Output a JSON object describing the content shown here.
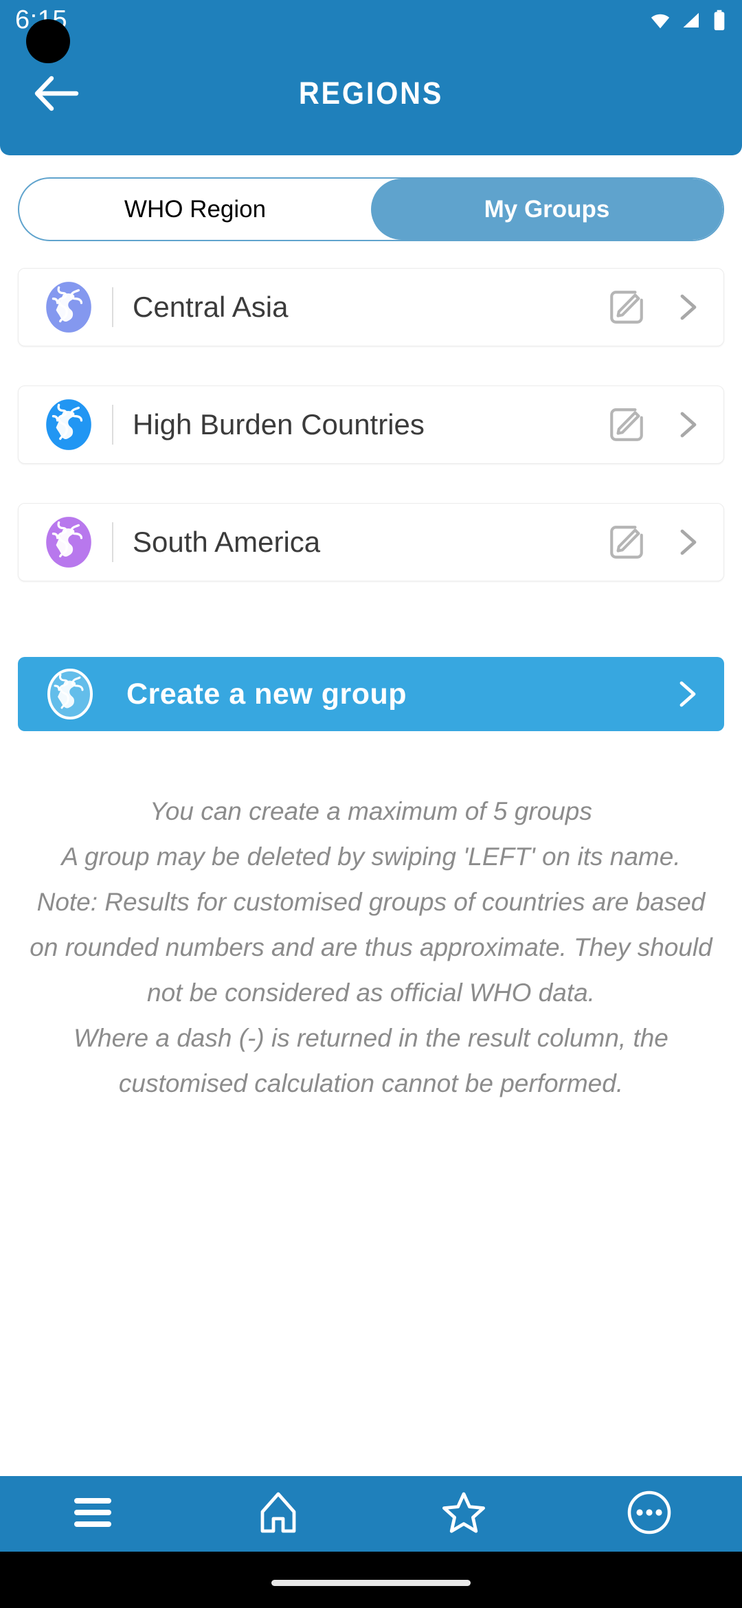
{
  "status_bar": {
    "time": "6:15",
    "icons": [
      "wifi-icon",
      "cellular-signal-icon",
      "battery-icon"
    ]
  },
  "header": {
    "title": "REGIONS",
    "back_icon": "back-arrow-icon",
    "background_color": "#1f80bb"
  },
  "tabs": {
    "items": [
      {
        "label": "WHO Region",
        "active": false
      },
      {
        "label": "My Groups",
        "active": true
      }
    ],
    "active_color": "#5fa3cd",
    "border_color": "#5fa3cd"
  },
  "groups": [
    {
      "name": "Central Asia",
      "globe_icon": "globe-icon",
      "globe_color": "#8498ef",
      "edit_icon": "edit-pencil-icon",
      "chevron_icon": "chevron-right-icon"
    },
    {
      "name": "High Burden Countries",
      "globe_icon": "globe-icon",
      "globe_color": "#2196f3",
      "edit_icon": "edit-pencil-icon",
      "chevron_icon": "chevron-right-icon"
    },
    {
      "name": "South America",
      "globe_icon": "globe-icon",
      "globe_color": "#b878ed",
      "edit_icon": "edit-pencil-icon",
      "chevron_icon": "chevron-right-icon"
    }
  ],
  "create_group": {
    "label": "Create a new group",
    "globe_icon": "globe-outline-icon",
    "chevron_icon": "chevron-right-icon",
    "background_color": "#37a7e0"
  },
  "help": {
    "lines": [
      "You can create a maximum of 5 groups",
      "A group may be deleted by swiping 'LEFT' on its name.",
      "Note: Results for customised groups of countries are based on rounded numbers and are thus approximate. They should not be considered as official WHO data.",
      "Where a dash (-) is returned in the result column, the customised calculation cannot be performed."
    ],
    "text_color": "#8c8c8c"
  },
  "bottom_nav": {
    "items": [
      {
        "icon": "hamburger-menu-icon",
        "name": "menu"
      },
      {
        "icon": "home-icon",
        "name": "home"
      },
      {
        "icon": "star-icon",
        "name": "favourites"
      },
      {
        "icon": "more-ellipsis-icon",
        "name": "more"
      }
    ],
    "background_color": "#1f80bb"
  }
}
